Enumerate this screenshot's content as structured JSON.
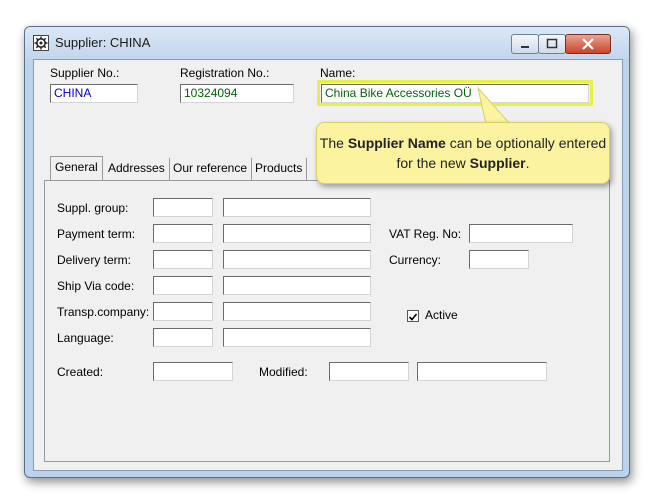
{
  "window": {
    "title": "Supplier: CHINA"
  },
  "header": {
    "supplier_no_label": "Supplier No.:",
    "supplier_no_value": "CHINA",
    "registration_no_label": "Registration No.:",
    "registration_no_value": "10324094",
    "name_label": "Name:",
    "name_value": "China Bike Accessories OÜ"
  },
  "tabs": [
    "General",
    "Addresses",
    "Our reference",
    "Products"
  ],
  "general": {
    "suppl_group_label": "Suppl. group:",
    "payment_term_label": "Payment term:",
    "delivery_term_label": "Delivery term:",
    "ship_via_label": "Ship Via code:",
    "transp_company_label": "Transp.company:",
    "language_label": "Language:",
    "created_label": "Created:",
    "modified_label": "Modified:",
    "vat_reg_label": "VAT Reg. No:",
    "currency_label": "Currency:",
    "active_label": "Active",
    "active_checked": true
  },
  "callout": {
    "part1": "The ",
    "bold1": "Supplier Name",
    "part2": " can be optionally entered for the new ",
    "bold2": "Supplier",
    "part3": "."
  },
  "colors": {
    "callout_bg": "#fbf3a0",
    "highlight": "#e6f046"
  }
}
